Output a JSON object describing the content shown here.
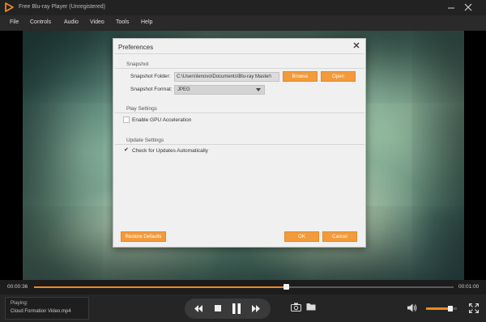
{
  "window": {
    "title": "Free Blu-ray Player (Unregistered)",
    "accent_color": "#f08a1c"
  },
  "menu": {
    "items": [
      "File",
      "Controls",
      "Audio",
      "Video",
      "Tools",
      "Help"
    ]
  },
  "dialog": {
    "title": "Preferences",
    "snapshot": {
      "section_label": "Snapshot",
      "folder_label": "Snapshot Folder:",
      "folder_value": "C:\\Users\\lenovo\\Documents\\Blu-ray Master\\",
      "browse_label": "Browse",
      "open_label": "Open",
      "format_label": "Snapshot Format:",
      "format_value": "JPEG"
    },
    "play_settings": {
      "section_label": "Play Settings",
      "gpu_label": "Enable GPU Acceleration",
      "gpu_checked": false
    },
    "update_settings": {
      "section_label": "Update Settings",
      "check_label": "Check for Updates Automatically",
      "check_checked": true
    },
    "restore_label": "Restore Defaults",
    "ok_label": "OK",
    "cancel_label": "Cancel"
  },
  "playback": {
    "current_time": "00:00:36",
    "total_time": "00:01:00",
    "progress_fraction": 0.6,
    "volume_fraction": 0.8
  },
  "now_playing": {
    "label": "Playing:",
    "file": "Cloud Formation Video.mp4"
  }
}
